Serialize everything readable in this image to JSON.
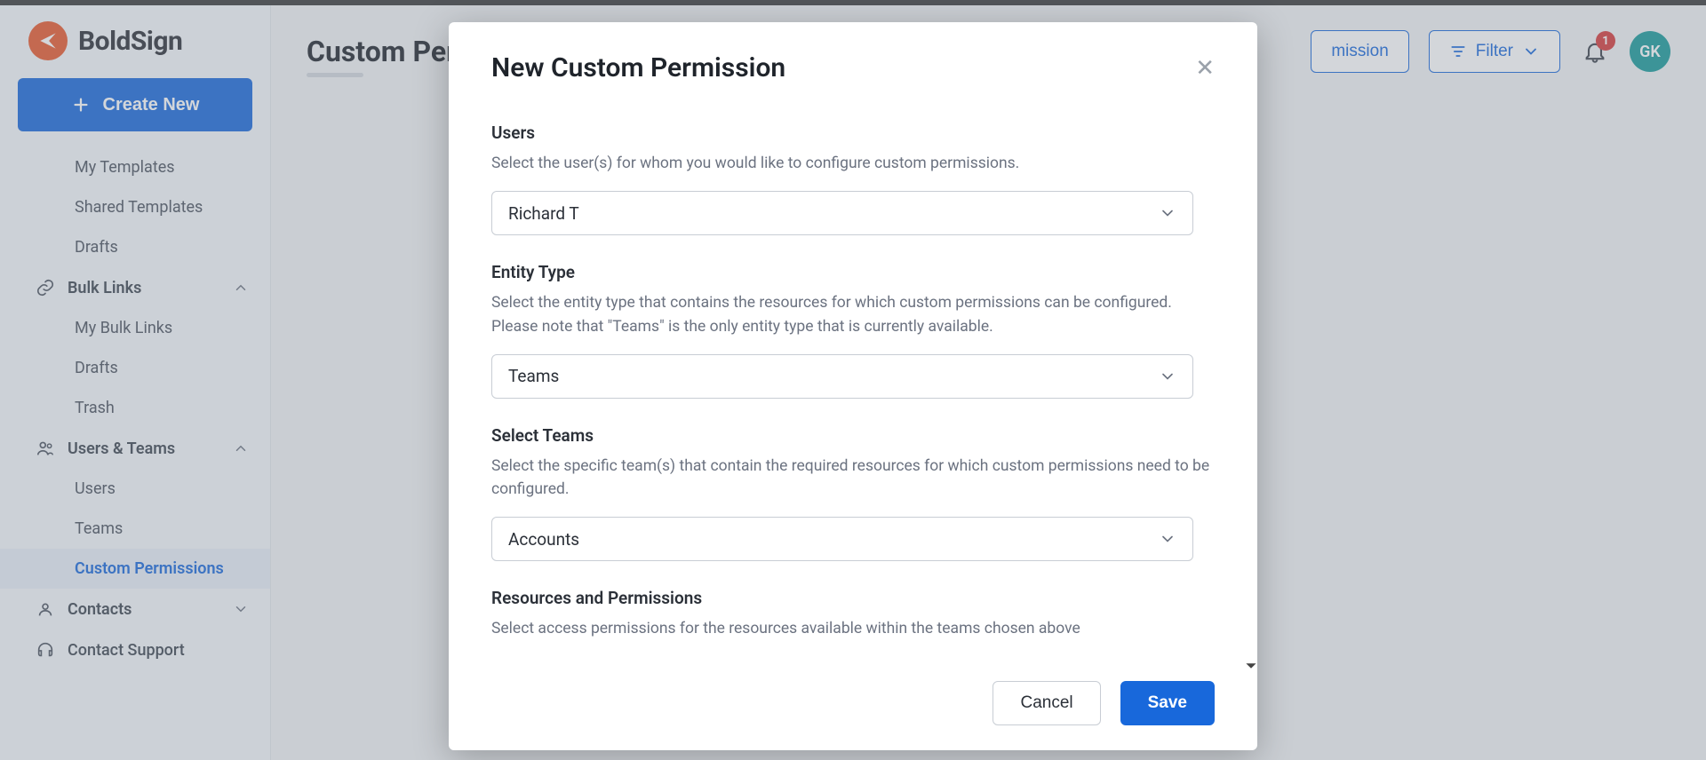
{
  "brand": {
    "name": "BoldSign"
  },
  "sidebar": {
    "create_label": "Create New",
    "items": [
      {
        "label": "My Templates",
        "type": "sub"
      },
      {
        "label": "Shared Templates",
        "type": "sub"
      },
      {
        "label": "Drafts",
        "type": "sub"
      }
    ],
    "bulk_links": {
      "label": "Bulk Links",
      "children": [
        "My Bulk Links",
        "Drafts",
        "Trash"
      ]
    },
    "users_teams": {
      "label": "Users & Teams",
      "children": [
        "Users",
        "Teams",
        "Custom Permissions"
      ]
    },
    "contacts_label": "Contacts",
    "support_label": "Contact Support"
  },
  "header": {
    "page_title": "Custom Permissions",
    "page_title_truncated": "Custom Per",
    "create_permission_btn": "Create Custom Permission",
    "create_permission_btn_truncated": "mission",
    "filter_btn": "Filter",
    "notif_count": "1",
    "avatar_initials": "GK"
  },
  "modal": {
    "title": "New Custom Permission",
    "users": {
      "label": "Users",
      "desc": "Select the user(s) for whom you would like to configure custom permissions.",
      "value": "Richard T"
    },
    "entity": {
      "label": "Entity Type",
      "desc": "Select the entity type that contains the resources for which custom permissions can be configured. Please note that \"Teams\" is the only entity type that is currently available.",
      "value": "Teams"
    },
    "teams": {
      "label": "Select Teams",
      "desc": "Select the specific team(s) that contain the required resources for which custom permissions need to be configured.",
      "value": "Accounts"
    },
    "resources": {
      "label": "Resources and Permissions",
      "desc": "Select access permissions for the resources available within the teams chosen above"
    },
    "cancel": "Cancel",
    "save": "Save"
  }
}
